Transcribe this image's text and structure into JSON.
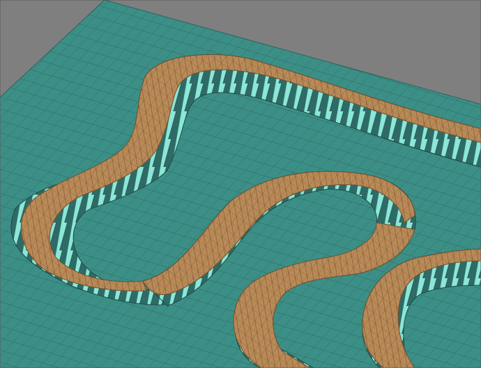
{
  "viewport": {
    "background_color": "#7f7f7f",
    "plate_color": "#3c8f86",
    "plate_grid_color": "#2a645e",
    "wall_light_color": "#79dccd",
    "wall_dark_color": "#2f6b66",
    "bead_color": "#b98a57",
    "bead_grid_color": "#6e4f2e"
  }
}
